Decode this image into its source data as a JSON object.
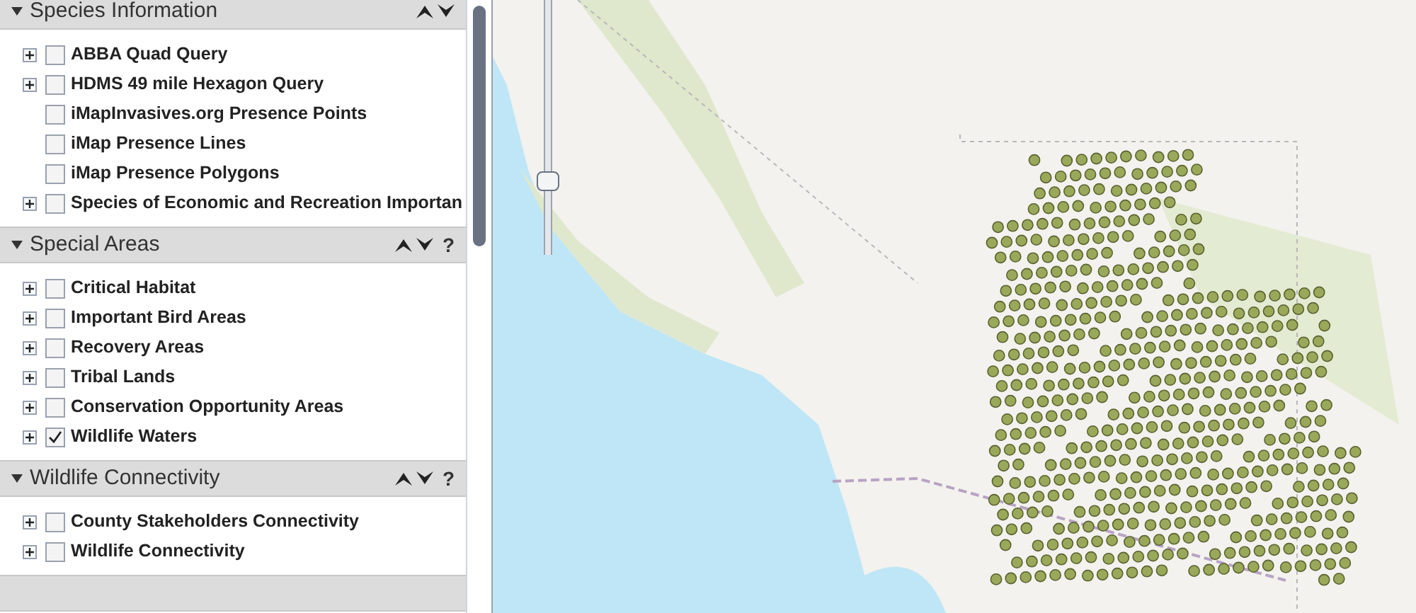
{
  "sections": [
    {
      "title": "Species Information",
      "expanded": true,
      "items": [
        {
          "label": "ABBA Quad Query",
          "expandable": true,
          "checked": false
        },
        {
          "label": "HDMS 49 mile Hexagon Query",
          "expandable": true,
          "checked": false
        },
        {
          "label": "iMapInvasives.org Presence Points",
          "expandable": false,
          "checked": false
        },
        {
          "label": "iMap Presence Lines",
          "expandable": false,
          "checked": false
        },
        {
          "label": "iMap Presence Polygons",
          "expandable": false,
          "checked": false
        },
        {
          "label": "Species of Economic and Recreation Importan",
          "expandable": true,
          "checked": false
        }
      ]
    },
    {
      "title": "Special Areas",
      "expanded": true,
      "help": "?",
      "items": [
        {
          "label": "Critical Habitat",
          "expandable": true,
          "checked": false
        },
        {
          "label": "Important Bird Areas",
          "expandable": true,
          "checked": false
        },
        {
          "label": "Recovery Areas",
          "expandable": true,
          "checked": false
        },
        {
          "label": "Tribal Lands",
          "expandable": true,
          "checked": false
        },
        {
          "label": "Conservation Opportunity Areas",
          "expandable": true,
          "checked": false
        },
        {
          "label": "Wildlife Waters",
          "expandable": true,
          "checked": true
        }
      ]
    },
    {
      "title": "Wildlife Connectivity",
      "expanded": true,
      "help": "?",
      "items": [
        {
          "label": "County Stakeholders Connectivity",
          "expandable": true,
          "checked": false
        },
        {
          "label": "Wildlife Connectivity",
          "expandable": true,
          "checked": false
        }
      ]
    }
  ],
  "zoom_slider": {
    "level": 0.26
  }
}
